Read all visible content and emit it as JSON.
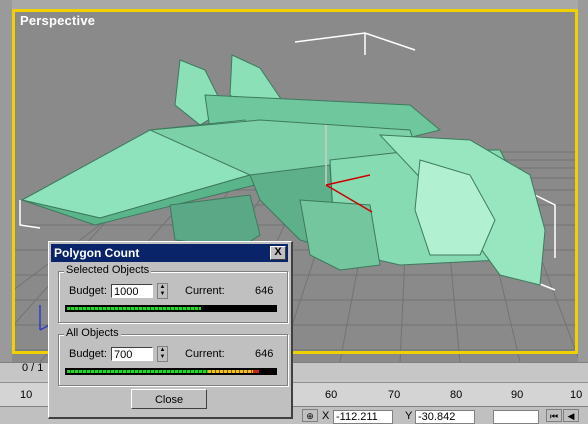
{
  "viewport": {
    "label": "Perspective"
  },
  "timeline": {
    "frame_counter": "0 / 1",
    "ticks": [
      "10",
      "60",
      "70",
      "80",
      "90",
      "10"
    ]
  },
  "dialog": {
    "title": "Polygon Count",
    "close_glyph": "X",
    "selected": {
      "group_label": "Selected Objects",
      "budget_label": "Budget:",
      "budget_value": "1000",
      "current_label": "Current:",
      "current_value": "646",
      "bar_fraction": 0.646
    },
    "all": {
      "group_label": "All Objects",
      "budget_label": "Budget:",
      "budget_value": "700",
      "current_label": "Current:",
      "current_value": "646",
      "bar_fraction": 0.923
    },
    "close_button": "Close"
  },
  "status": {
    "x_label": "X",
    "x_value": "-112.211",
    "y_label": "Y",
    "y_value": "-30.842"
  },
  "colors": {
    "viewport_border": "#f0d000",
    "mesh": "#7fd6ac",
    "title_bar": "#0a246a"
  }
}
